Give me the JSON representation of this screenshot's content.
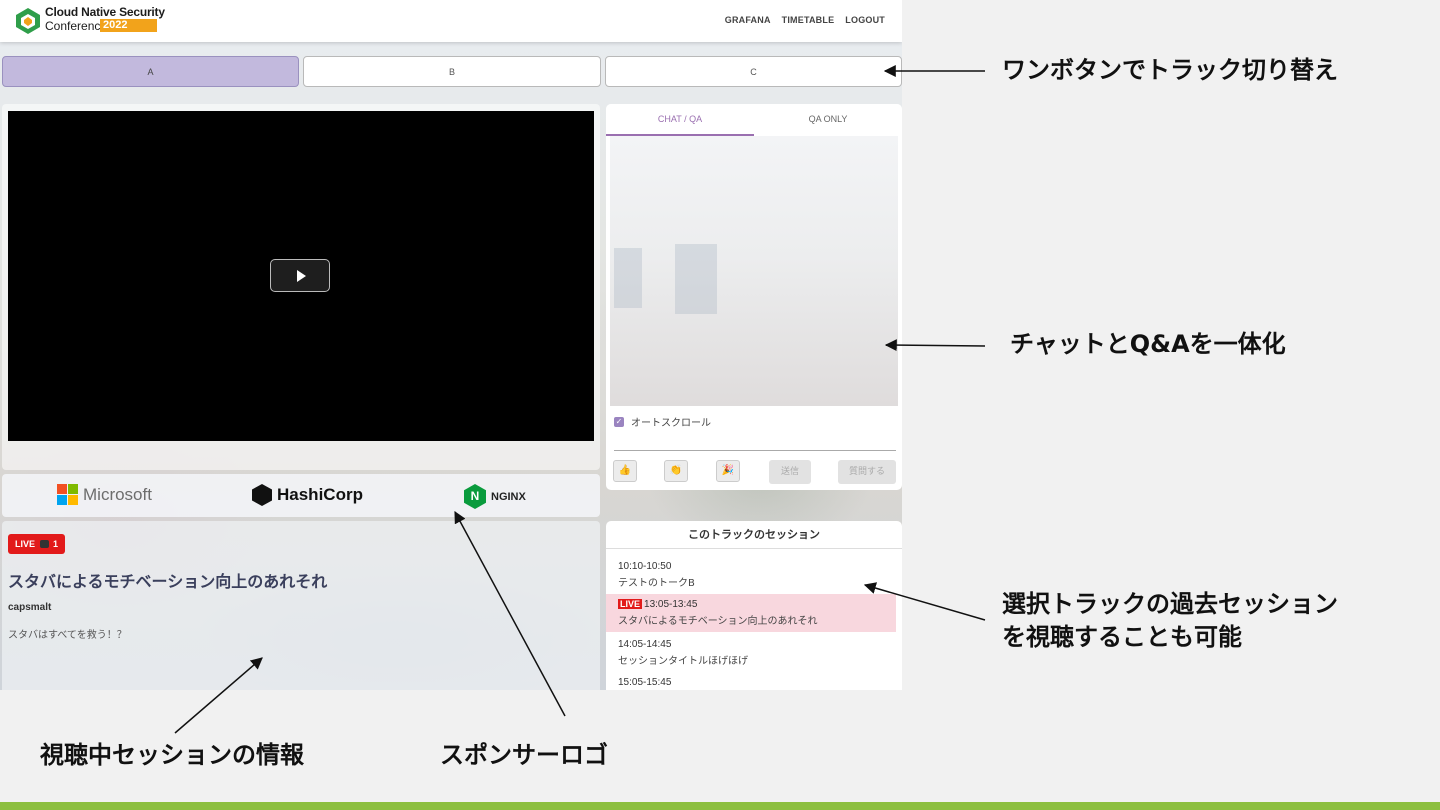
{
  "header": {
    "logo_line1": "Cloud Native Security",
    "logo_line2": "Conference",
    "logo_year": "2022",
    "nav": [
      "GRAFANA",
      "TIMETABLE",
      "LOGOUT"
    ]
  },
  "tracks": [
    "A",
    "B",
    "C"
  ],
  "active_track": "A",
  "sponsors": {
    "microsoft": "Microsoft",
    "hashicorp": "HashiCorp",
    "nginx_letter": "N",
    "nginx": "NGINX"
  },
  "session": {
    "live_label": "LIVE",
    "viewers": "1",
    "title": "スタバによるモチベーション向上のあれそれ",
    "speaker": "capsmalt",
    "description": "スタバはすべてを救う！？"
  },
  "chat": {
    "tabs": [
      "CHAT / QA",
      "QA ONLY"
    ],
    "autoscroll_label": "オートスクロール",
    "send_label": "送信",
    "ask_label": "質問する"
  },
  "sessions": {
    "heading": "このトラックのセッション",
    "items": [
      {
        "time": "10:10-10:50",
        "title": "テストのトークB",
        "live": false
      },
      {
        "time": "13:05-13:45",
        "title": "スタバによるモチベーション向上のあれそれ",
        "live": true
      },
      {
        "time": "14:05-14:45",
        "title": "セッションタイトルほげほげ",
        "live": false
      },
      {
        "time": "15:05-15:45",
        "title": "",
        "live": false
      }
    ],
    "live_tag": "LIVE"
  },
  "annotations": {
    "track_switch": "ワンボタンでトラック切り替え",
    "chat_qa": "チャットとQ&Aを一体化",
    "past_sessions_1": "選択トラックの過去セッション",
    "past_sessions_2": "を視聴することも可能",
    "session_info": "視聴中セッションの情報",
    "sponsor_logo": "スポンサーロゴ"
  },
  "colors": {
    "accent": "#9a6fb0",
    "active_track": "#c2b9dd",
    "live": "#e21a1a",
    "live_row": "#f8d7de",
    "nginx": "#0a9b3d",
    "bottom_strip": "#8cbf3f"
  }
}
